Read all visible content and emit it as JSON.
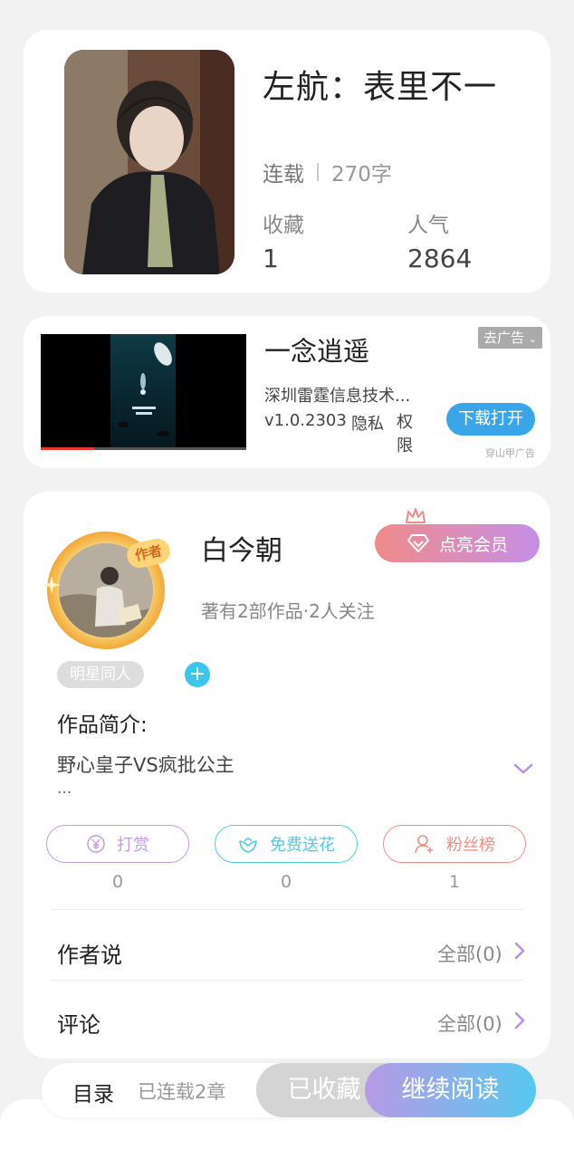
{
  "book": {
    "title": "左航：表里不一",
    "status": "连载",
    "word_count": "270字",
    "collect_label": "收藏",
    "collect_value": "1",
    "popularity_label": "人气",
    "popularity_value": "2864"
  },
  "ad": {
    "app_name": "一念逍遥",
    "company": "深圳雷霆信息技术...",
    "version": "v1.0.2303",
    "privacy": "隐私",
    "permissions": "权限",
    "close_label": "去广告",
    "download_label": "下载打开",
    "source": "穿山甲广告",
    "progress": 0.26
  },
  "author": {
    "badge": "作者",
    "name": "白今朝",
    "meta": "著有2部作品·2人关注",
    "vip_label": "点亮会员",
    "tag": "明星同人",
    "add_tag": "+",
    "intro_label": "作品简介:",
    "intro_text": "野心皇子VS疯批公主",
    "intro_more": "...",
    "actions": [
      {
        "label": "打赏",
        "count": "0",
        "color": "#c49be6"
      },
      {
        "label": "免费送花",
        "count": "0",
        "color": "#4fcbe6"
      },
      {
        "label": "粉丝榜",
        "count": "1",
        "color": "#ee8f85"
      }
    ],
    "author_says_label": "作者说",
    "author_says_all": "全部(0)",
    "comments_label": "评论",
    "comments_all": "全部(0)",
    "accent": "#b392e0"
  },
  "bottom": {
    "toc_label": "目录",
    "serial_info": "已连载2章",
    "collected_label": "已收藏",
    "continue_label": "继续阅读"
  }
}
